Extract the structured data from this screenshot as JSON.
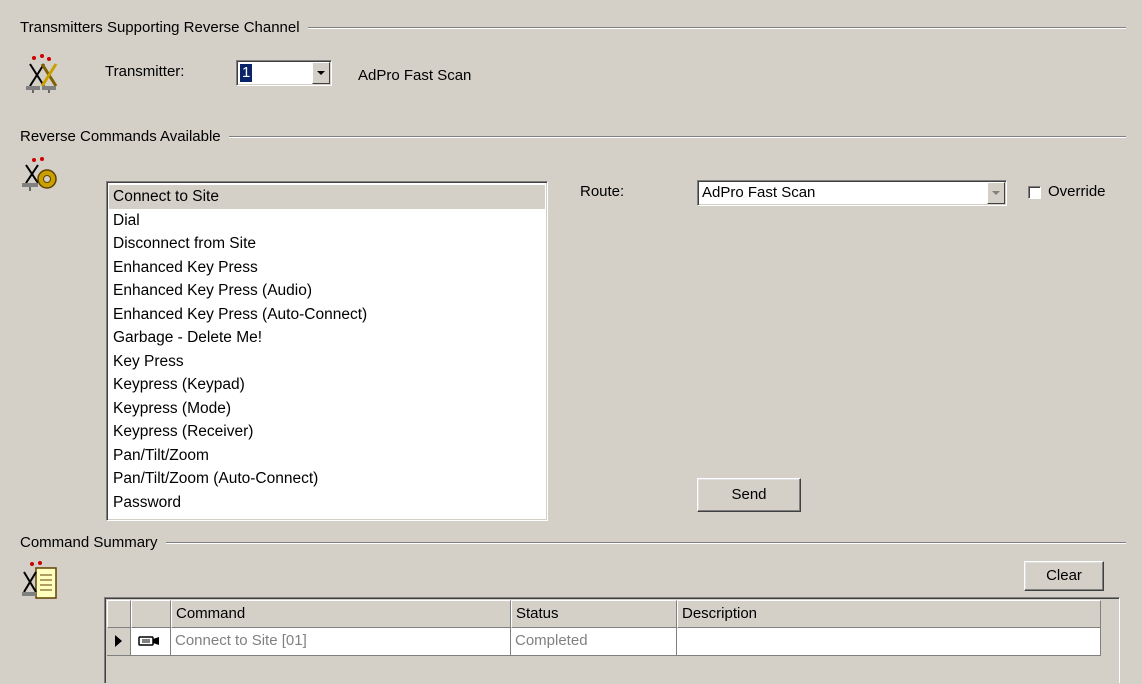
{
  "transmitters_section": {
    "title": "Transmitters Supporting Reverse Channel",
    "transmitter_label": "Transmitter:",
    "transmitter_value": "1",
    "transmitter_name": "AdPro Fast Scan"
  },
  "commands_section": {
    "title": "Reverse Commands Available",
    "commands": [
      "Connect to Site",
      "Dial",
      "Disconnect from Site",
      "Enhanced Key Press",
      "Enhanced Key Press (Audio)",
      "Enhanced Key Press (Auto-Connect)",
      "Garbage - Delete Me!",
      "Key Press",
      "Keypress (Keypad)",
      "Keypress (Mode)",
      "Keypress (Receiver)",
      "Pan/Tilt/Zoom",
      "Pan/Tilt/Zoom (Auto-Connect)",
      "Password"
    ],
    "selected_index": 0,
    "route_label": "Route:",
    "route_value": "AdPro Fast Scan",
    "override_label": "Override",
    "override_checked": false,
    "send_label": "Send"
  },
  "summary_section": {
    "title": "Command Summary",
    "clear_label": "Clear",
    "columns": [
      "Command",
      "Status",
      "Description"
    ],
    "rows": [
      {
        "command": "Connect to Site [01]",
        "status": "Completed",
        "description": ""
      }
    ]
  },
  "icons": {
    "transmitter": "transmitter-antenna-icon",
    "commands": "commands-gear-icon",
    "summary": "summary-document-icon",
    "row_indicator": "row-pointer-icon",
    "row_type": "camera-icon"
  }
}
